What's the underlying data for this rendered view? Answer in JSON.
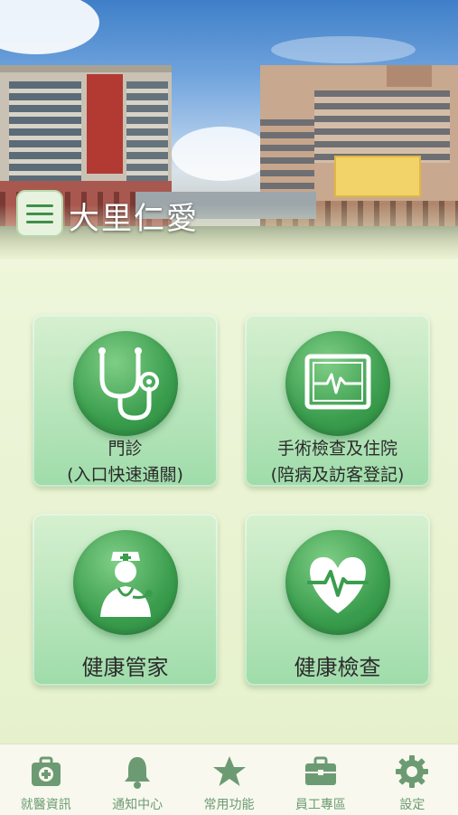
{
  "header": {
    "app_title": "大里仁愛",
    "menu_icon": "hamburger-menu-icon",
    "background": "hospital-building-photo"
  },
  "cards": [
    {
      "line1": "門診",
      "line2": "(入口快速通關)",
      "icon": "stethoscope-icon"
    },
    {
      "line1": "手術檢查及住院",
      "line2": "(陪病及訪客登記)",
      "icon": "heart-monitor-icon"
    },
    {
      "label": "健康管家",
      "icon": "nurse-icon"
    },
    {
      "label": "健康檢查",
      "icon": "heart-pulse-icon"
    }
  ],
  "tabs": [
    {
      "label": "就醫資訊",
      "icon": "medical-kit-icon"
    },
    {
      "label": "通知中心",
      "icon": "bell-icon"
    },
    {
      "label": "常用功能",
      "icon": "star-icon"
    },
    {
      "label": "員工專區",
      "icon": "briefcase-icon"
    },
    {
      "label": "設定",
      "icon": "gear-icon"
    }
  ],
  "colors": {
    "accent_green": "#3a9d4d",
    "tab_icon_green": "#6c9b73",
    "card_gradient_top": "#d6f0d0",
    "card_gradient_bottom": "#9fdcaa"
  }
}
